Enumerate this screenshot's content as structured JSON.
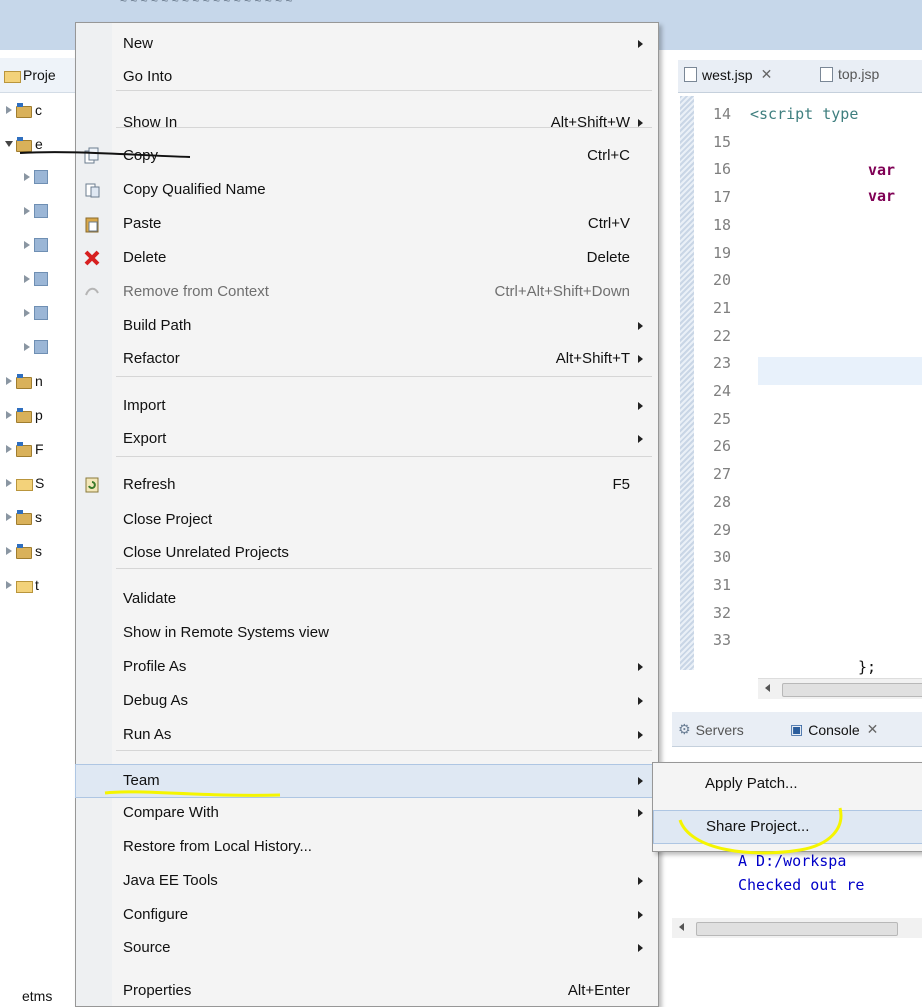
{
  "top_text": "~ ~ ~ ~ ~ ~ ~ ~ ~ ~ ~ ~ ~ ~ ~ ~ ~",
  "explorer": {
    "tab_label": "Proje",
    "rows": [
      {
        "label": "c"
      },
      {
        "label": "e"
      },
      {
        "label": ""
      },
      {
        "label": ""
      },
      {
        "label": ""
      },
      {
        "label": ""
      },
      {
        "label": ""
      },
      {
        "label": ""
      },
      {
        "label": "n"
      },
      {
        "label": "p"
      },
      {
        "label": "F"
      },
      {
        "label": "S"
      },
      {
        "label": "s"
      },
      {
        "label": "s"
      },
      {
        "label": "t"
      }
    ],
    "bottom_item": "etms"
  },
  "editor": {
    "tabs": [
      {
        "label": "west.jsp"
      },
      {
        "label": "top.jsp"
      }
    ],
    "line_numbers": [
      "14",
      "15",
      "16",
      "17",
      "18",
      "19",
      "20",
      "21",
      "22",
      "23",
      "24",
      "25",
      "26",
      "27",
      "28",
      "29",
      "30",
      "31",
      "32",
      "33"
    ],
    "line14_code": "<script type",
    "keyword_var": "var",
    "line33_code": "};"
  },
  "bottom_panel": {
    "tabs": [
      {
        "label": "Servers"
      },
      {
        "label": "Console"
      }
    ],
    "console_lines": [
      "A   D:/workspa",
      "Checked out re"
    ]
  },
  "context_menu": {
    "items": [
      {
        "label": "New",
        "shortcut": "",
        "submenu": true
      },
      {
        "label": "Go Into",
        "shortcut": "",
        "submenu": false
      },
      {
        "label": "Show In",
        "shortcut": "Alt+Shift+W",
        "submenu": true
      },
      {
        "label": "Copy",
        "shortcut": "Ctrl+C",
        "submenu": false,
        "icon": "copy-icon"
      },
      {
        "label": "Copy Qualified Name",
        "shortcut": "",
        "submenu": false,
        "icon": "copy-qualified-name-icon"
      },
      {
        "label": "Paste",
        "shortcut": "Ctrl+V",
        "submenu": false,
        "icon": "paste-icon"
      },
      {
        "label": "Delete",
        "shortcut": "Delete",
        "submenu": false,
        "icon": "delete-icon"
      },
      {
        "label": "Remove from Context",
        "shortcut": "Ctrl+Alt+Shift+Down",
        "submenu": false,
        "disabled": true,
        "icon": "remove-context-icon"
      },
      {
        "label": "Build Path",
        "shortcut": "",
        "submenu": true
      },
      {
        "label": "Refactor",
        "shortcut": "Alt+Shift+T",
        "submenu": true
      },
      {
        "label": "Import",
        "shortcut": "",
        "submenu": true
      },
      {
        "label": "Export",
        "shortcut": "",
        "submenu": true
      },
      {
        "label": "Refresh",
        "shortcut": "F5",
        "submenu": false,
        "icon": "refresh-icon"
      },
      {
        "label": "Close Project",
        "shortcut": "",
        "submenu": false
      },
      {
        "label": "Close Unrelated Projects",
        "shortcut": "",
        "submenu": false
      },
      {
        "label": "Validate",
        "shortcut": "",
        "submenu": false
      },
      {
        "label": "Show in Remote Systems view",
        "shortcut": "",
        "submenu": false
      },
      {
        "label": "Profile As",
        "shortcut": "",
        "submenu": true
      },
      {
        "label": "Debug As",
        "shortcut": "",
        "submenu": true
      },
      {
        "label": "Run As",
        "shortcut": "",
        "submenu": true
      },
      {
        "label": "Team",
        "shortcut": "",
        "submenu": true,
        "highlighted": true
      },
      {
        "label": "Compare With",
        "shortcut": "",
        "submenu": true
      },
      {
        "label": "Restore from Local History...",
        "shortcut": "",
        "submenu": false
      },
      {
        "label": "Java EE Tools",
        "shortcut": "",
        "submenu": true
      },
      {
        "label": "Configure",
        "shortcut": "",
        "submenu": true
      },
      {
        "label": "Source",
        "shortcut": "",
        "submenu": true
      },
      {
        "label": "Properties",
        "shortcut": "Alt+Enter",
        "submenu": false
      }
    ]
  },
  "team_submenu": {
    "items": [
      {
        "label": "Apply Patch..."
      },
      {
        "label": "Share Project...",
        "highlighted": true
      }
    ]
  },
  "annotation_color": "#f5f500"
}
